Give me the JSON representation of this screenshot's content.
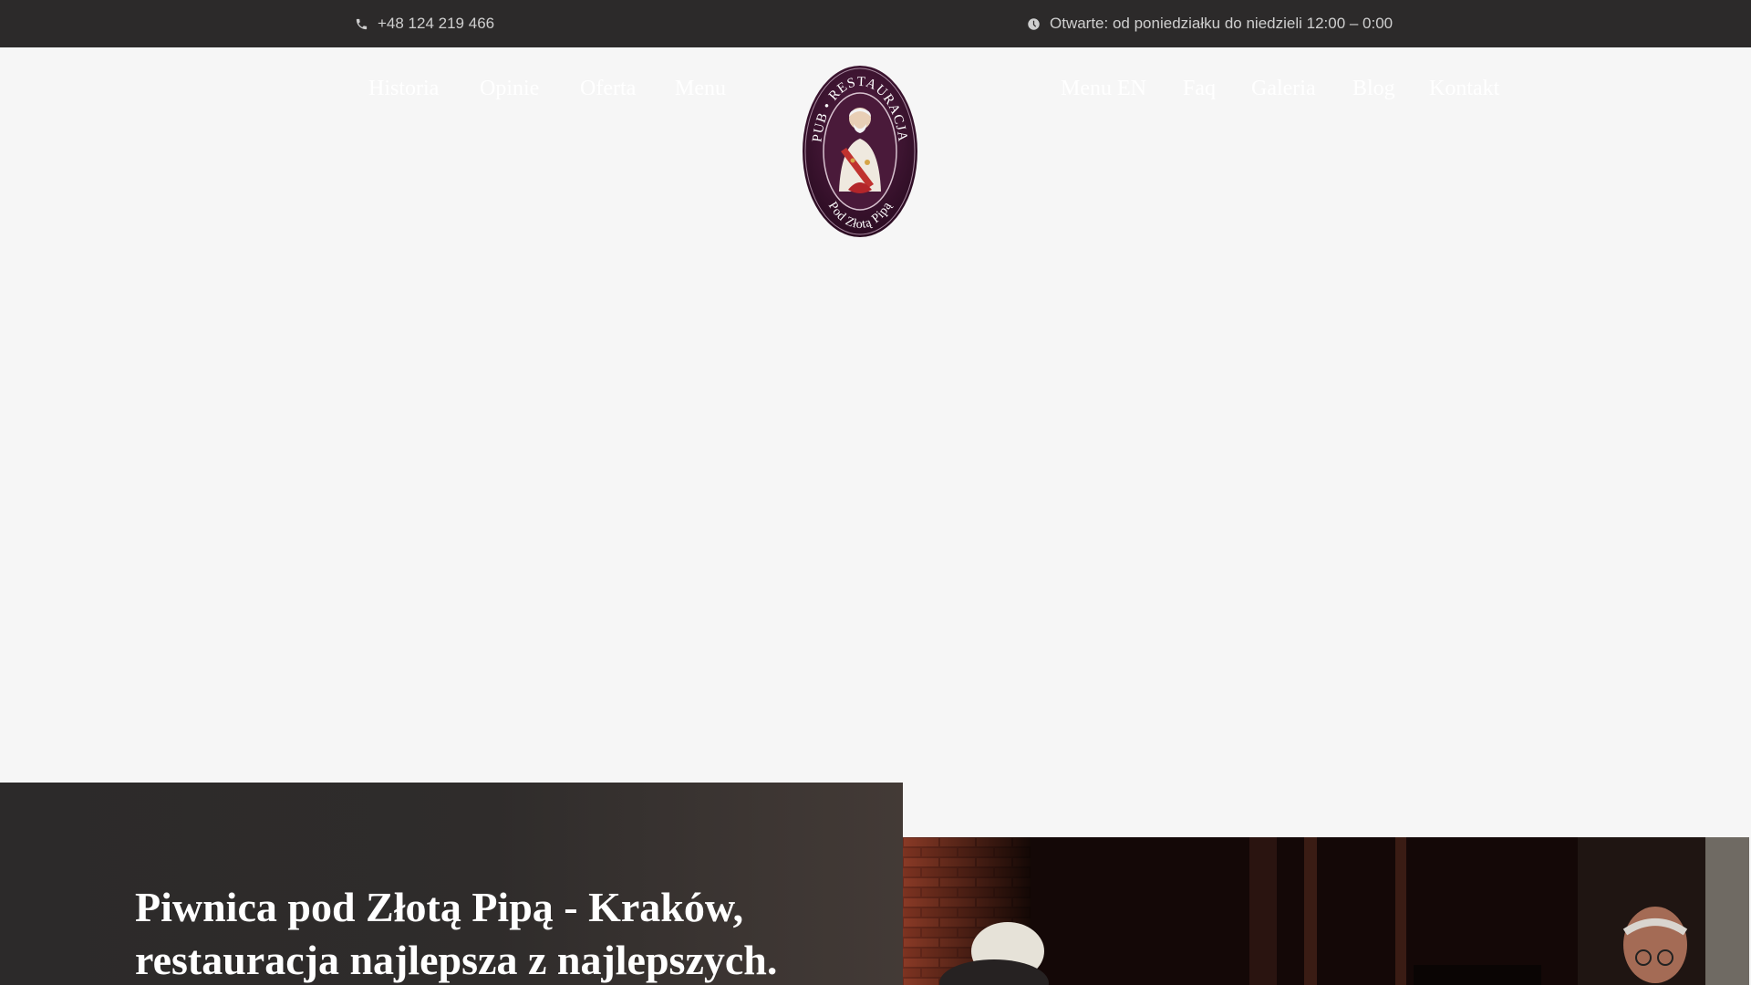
{
  "topbar": {
    "phone": "+48 124 219 466",
    "phone_icon": "phone-icon",
    "hours": "Otwarte: od poniedziałku do niedzieli 12:00 – 0:00",
    "hours_icon": "clock-icon"
  },
  "nav": {
    "left": [
      "Historia",
      "Opinie",
      "Oferta",
      "Menu"
    ],
    "right": [
      "Menu EN",
      "Faq",
      "Galeria",
      "Blog",
      "Kontakt"
    ]
  },
  "logo": {
    "top_text": "PUB • RESTAURACJA",
    "bottom_text": "Pod Złotą Pipą"
  },
  "hero": {
    "title_line1": "Piwnica pod Złotą Pipą - Kraków,",
    "title_line2": "restauracja najlepsza z najlepszych."
  },
  "colors": {
    "topbar_bg": "#2c2a2a",
    "page_bg": "#f6f6f6",
    "logo_bg": "#3a1330"
  }
}
